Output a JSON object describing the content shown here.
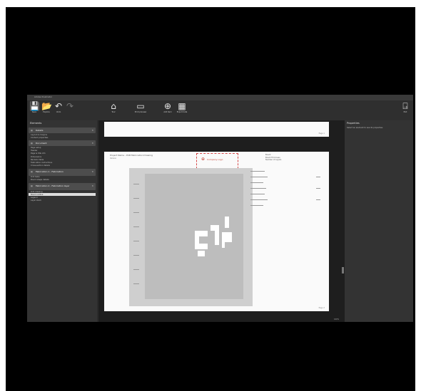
{
  "window": {
    "title": "Adobe Illustrator"
  },
  "toolbar": {
    "left": [
      {
        "name": "save",
        "icon": "save-icon",
        "label": "Save"
      },
      {
        "name": "open",
        "icon": "folder-icon",
        "label": "Explore"
      },
      {
        "name": "undo",
        "icon": "undo-icon",
        "label": "Undo"
      },
      {
        "name": "redo",
        "icon": "redo-icon",
        "label": ""
      }
    ],
    "center": [
      {
        "name": "home",
        "icon": "home-icon",
        "label": "Tour"
      },
      {
        "name": "preview",
        "icon": "preview-icon",
        "label": "Print preview"
      },
      {
        "name": "add",
        "icon": "add-icon",
        "label": "Add item"
      },
      {
        "name": "export",
        "icon": "export-icon",
        "label": "Export data"
      }
    ],
    "right": {
      "icon": "exit-icon",
      "label": "Exit"
    }
  },
  "left_panel": {
    "heading": "Elements",
    "groups": [
      {
        "title": "Details",
        "items": [
          "Layout & margins",
          "Content properties"
        ]
      },
      {
        "title": "Document",
        "items": [
          "Page setup",
          "Header",
          "Page & title info",
          "Dimensions",
          "Revision table",
          "Fabrication instructions",
          "Cross-section details"
        ]
      },
      {
        "title": "Fabrication 1 - Fabrication",
        "items": [
          "Drill table",
          "Board shape details"
        ]
      },
      {
        "title": "Fabrication 2 - Fabrication layer",
        "items": [
          "Drill drawing",
          "Board outline",
          "Legend",
          "Layer stack"
        ],
        "selected": 1
      }
    ]
  },
  "document": {
    "page1_number": "Page 1",
    "page2_number": "Page 2",
    "header_left": "Project Name - PCB Fabrication Drawing",
    "header_sub": "Version",
    "logo_text": "Company Logo",
    "right_fields": [
      "Board",
      "Board Thickness",
      "Number of Layers"
    ]
  },
  "right_panel": {
    "heading": "Properties",
    "text": "Select an element to see its properties"
  },
  "status": {
    "zoom": "100%"
  }
}
